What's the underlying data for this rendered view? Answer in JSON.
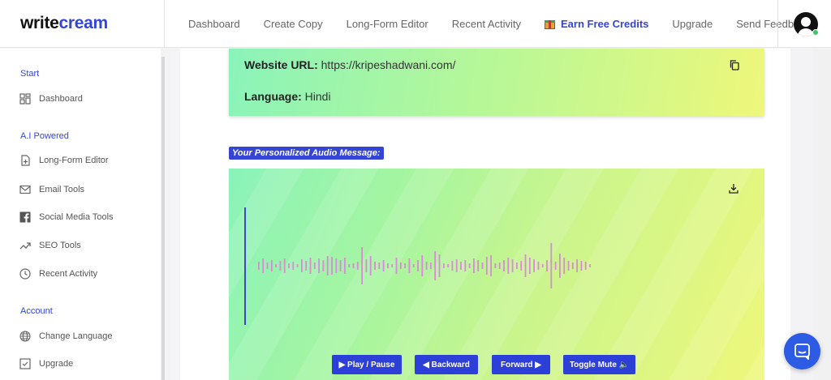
{
  "header": {
    "logo_part1": "write",
    "logo_part2": "cream",
    "nav": [
      {
        "label": "Dashboard"
      },
      {
        "label": "Create Copy"
      },
      {
        "label": "Long-Form Editor"
      },
      {
        "label": "Recent Activity"
      },
      {
        "label": "Earn Free Credits",
        "icon": "gift-icon",
        "active": true
      },
      {
        "label": "Upgrade"
      },
      {
        "label": "Send Feedback"
      }
    ],
    "avatar_icon": "user-avatar-icon"
  },
  "sidebar": {
    "sections": [
      {
        "title": "Start",
        "items": [
          {
            "label": "Dashboard",
            "icon": "dashboard-icon"
          }
        ]
      },
      {
        "title": "A.I Powered",
        "items": [
          {
            "label": "Long-Form Editor",
            "icon": "file-plus-icon"
          },
          {
            "label": "Email Tools",
            "icon": "mail-icon"
          },
          {
            "label": "Social Media Tools",
            "icon": "facebook-icon"
          },
          {
            "label": "SEO Tools",
            "icon": "trend-icon"
          },
          {
            "label": "Recent Activity",
            "icon": "clock-icon"
          }
        ]
      },
      {
        "title": "Account",
        "items": [
          {
            "label": "Change Language",
            "icon": "globe-icon"
          },
          {
            "label": "Upgrade",
            "icon": "checkbox-icon"
          }
        ]
      }
    ]
  },
  "info": {
    "website_label": "Website URL:",
    "website_value": "https://kripeshadwani.com/",
    "language_label": "Language:",
    "language_value": "Hindi",
    "copy_icon": "copy-icon"
  },
  "audio": {
    "heading": "Your Personalized Audio Message:",
    "download_icon": "download-icon",
    "controls": {
      "play_pause": "▶ Play / Pause",
      "backward": "◀ Backward",
      "forward": "Forward ▶",
      "toggle_mute": "Toggle Mute 🔈"
    }
  },
  "colors": {
    "accent": "#3445d6",
    "button": "#2c3fd8",
    "wave": "#d98ad8",
    "playhead": "#4a3fd1",
    "chat": "#2d5be3"
  },
  "chat_icon": "chat-icon"
}
